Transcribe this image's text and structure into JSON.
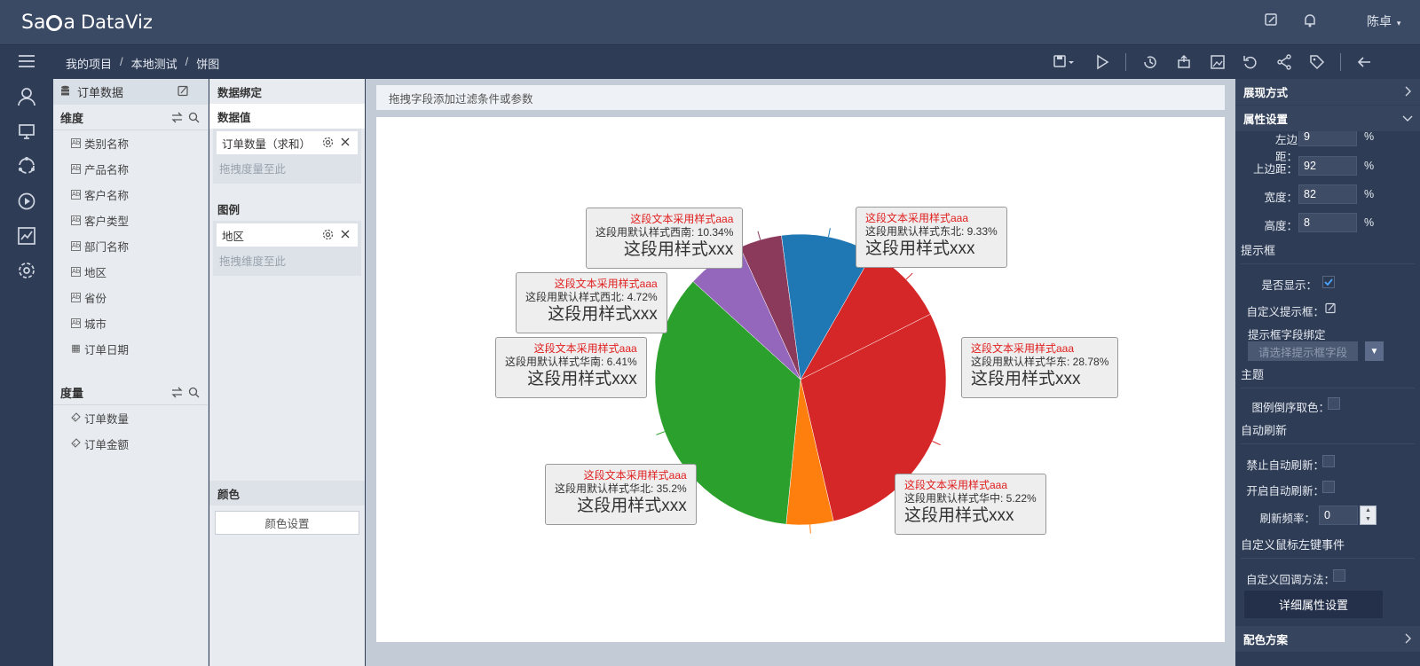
{
  "app": {
    "brand": "DataViz",
    "brand_left": "Sa",
    "brand_mid": "a",
    "user": "陈卓"
  },
  "breadcrumb": [
    "我的项目",
    "本地测试",
    "饼图"
  ],
  "fields_panel": {
    "dataset": "订单数据",
    "dimension_title": "维度",
    "dimensions": [
      {
        "label": "类别名称",
        "icon": "text-field-icon"
      },
      {
        "label": "产品名称",
        "icon": "text-field-icon"
      },
      {
        "label": "客户名称",
        "icon": "text-field-icon"
      },
      {
        "label": "客户类型",
        "icon": "text-field-icon"
      },
      {
        "label": "部门名称",
        "icon": "text-field-icon"
      },
      {
        "label": "地区",
        "icon": "text-field-icon"
      },
      {
        "label": "省份",
        "icon": "text-field-icon"
      },
      {
        "label": "城市",
        "icon": "text-field-icon"
      },
      {
        "label": "订单日期",
        "icon": "date-field-icon"
      }
    ],
    "measure_title": "度量",
    "measures": [
      {
        "label": "订单数量",
        "icon": "ruler-icon"
      },
      {
        "label": "订单金额",
        "icon": "ruler-icon"
      }
    ]
  },
  "binding": {
    "title": "数据绑定",
    "value_title": "数据值",
    "value_chip": "订单数量（求和）",
    "value_hint": "拖拽度量至此",
    "legend_title": "图例",
    "legend_chip": "地区",
    "legend_hint": "拖拽维度至此",
    "color_title": "颜色",
    "color_button": "颜色设置"
  },
  "main": {
    "filter_placeholder": "拖拽字段添加过滤条件或参数"
  },
  "chart_data": {
    "type": "pie",
    "slices": [
      {
        "name": "东北",
        "value": 9.33,
        "color": "#d62728"
      },
      {
        "name": "华东",
        "value": 28.78,
        "color": "#d62728"
      },
      {
        "name": "华中",
        "value": 5.22,
        "color": "#ff7f0e"
      },
      {
        "name": "华北",
        "value": 35.2,
        "color": "#2ca02c"
      },
      {
        "name": "华南",
        "value": 6.41,
        "color": "#9467bd"
      },
      {
        "name": "西北",
        "value": 4.72,
        "color": "#8c3a5c"
      },
      {
        "name": "西南",
        "value": 10.34,
        "color": "#1f77b4"
      }
    ],
    "labels": [
      {
        "styled": "这段文本采用样式aaa",
        "default": "这段用默认样式西南: 10.34%",
        "big": "这段用样式xxx"
      },
      {
        "styled": "这段文本采用样式aaa",
        "default": "这段用默认样式东北: 9.33%",
        "big": "这段用样式xxx"
      },
      {
        "styled": "这段文本采用样式aaa",
        "default": "这段用默认样式西北: 4.72%",
        "big": "这段用样式xxx"
      },
      {
        "styled": "这段文本采用样式aaa",
        "default": "这段用默认样式华东: 28.78%",
        "big": "这段用样式xxx"
      },
      {
        "styled": "这段文本采用样式aaa",
        "default": "这段用默认样式华南: 6.41%",
        "big": "这段用样式xxx"
      },
      {
        "styled": "这段文本采用样式aaa",
        "default": "这段用默认样式华北: 35.2%",
        "big": "这段用样式xxx"
      },
      {
        "styled": "这段文本采用样式aaa",
        "default": "这段用默认样式华中: 5.22%",
        "big": "这段用样式xxx"
      }
    ]
  },
  "right_panel": {
    "display_mode": "展现方式",
    "property_settings": "属性设置",
    "left_margin_label": "左边距：",
    "left_margin": "9",
    "top_margin_label": "上边距：",
    "top_margin": "92",
    "width_label": "宽度：",
    "width": "82",
    "height_label": "高度：",
    "height": "8",
    "unit": "%",
    "tooltip_group": "提示框",
    "show_label": "是否显示：",
    "custom_tooltip_label": "自定义提示框：",
    "tooltip_field_label": "提示框字段绑定",
    "tooltip_field_placeholder": "请选择提示框字段",
    "theme_group": "主题",
    "legend_reverse_label": "图例倒序取色：",
    "auto_refresh_group": "自动刷新",
    "disable_refresh_label": "禁止自动刷新：",
    "enable_refresh_label": "开启自动刷新：",
    "refresh_rate_label": "刷新频率：",
    "refresh_rate": "0",
    "click_event_group": "自定义鼠标左键事件",
    "callback_label": "自定义回调方法：",
    "detail_button": "详细属性设置",
    "color_scheme": "配色方案"
  }
}
